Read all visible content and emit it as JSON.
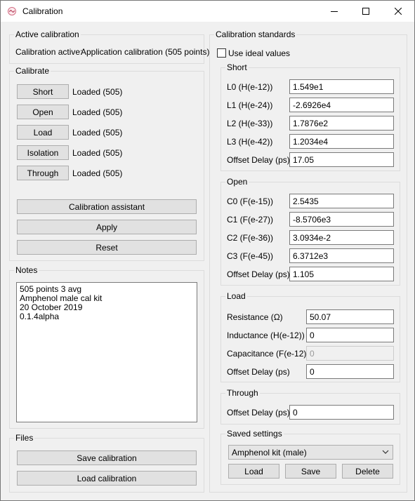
{
  "window": {
    "title": "Calibration"
  },
  "active": {
    "group_title": "Active calibration",
    "prefix": "Calibration active:",
    "value": "Application calibration (505 points)"
  },
  "calibrate": {
    "group_title": "Calibrate",
    "rows": [
      {
        "button": "Short",
        "status": "Loaded (505)"
      },
      {
        "button": "Open",
        "status": "Loaded (505)"
      },
      {
        "button": "Load",
        "status": "Loaded (505)"
      },
      {
        "button": "Isolation",
        "status": "Loaded (505)"
      },
      {
        "button": "Through",
        "status": "Loaded (505)"
      }
    ],
    "assistant": "Calibration assistant",
    "apply": "Apply",
    "reset": "Reset"
  },
  "notes": {
    "group_title": "Notes",
    "lines": [
      "505 points 3 avg",
      "Amphenol male cal kit",
      "20 October 2019",
      "0.1.4alpha"
    ]
  },
  "files": {
    "group_title": "Files",
    "save": "Save calibration",
    "load": "Load calibration"
  },
  "standards": {
    "group_title": "Calibration standards",
    "ideal_label": "Use ideal values",
    "ideal_checked": false,
    "short": {
      "title": "Short",
      "fields": [
        {
          "label": "L0 (H(e-12))",
          "value": "1.549e1"
        },
        {
          "label": "L1 (H(e-24))",
          "value": "-2.6926e4"
        },
        {
          "label": "L2 (H(e-33))",
          "value": "1.7876e2"
        },
        {
          "label": "L3 (H(e-42))",
          "value": "1.2034e4"
        },
        {
          "label": "Offset Delay (ps)",
          "value": "17.05"
        }
      ]
    },
    "open": {
      "title": "Open",
      "fields": [
        {
          "label": "C0 (F(e-15))",
          "value": "2.5435"
        },
        {
          "label": "C1 (F(e-27))",
          "value": "-8.5706e3"
        },
        {
          "label": "C2 (F(e-36))",
          "value": "3.0934e-2"
        },
        {
          "label": "C3 (F(e-45))",
          "value": "6.3712e3"
        },
        {
          "label": "Offset Delay (ps)",
          "value": "1.105"
        }
      ]
    },
    "load": {
      "title": "Load",
      "fields": [
        {
          "label": "Resistance (Ω)",
          "value": "50.07"
        },
        {
          "label": "Inductance (H(e-12))",
          "value": "0"
        },
        {
          "label": "Capacitance (F(e-12))",
          "value": "0"
        },
        {
          "label": "Offset Delay (ps)",
          "value": "0"
        }
      ]
    },
    "through": {
      "title": "Through",
      "fields": [
        {
          "label": "Offset Delay (ps)",
          "value": "0"
        }
      ]
    },
    "saved": {
      "title": "Saved settings",
      "selected": "Amphenol kit (male)",
      "load": "Load",
      "save": "Save",
      "delete": "Delete"
    }
  }
}
